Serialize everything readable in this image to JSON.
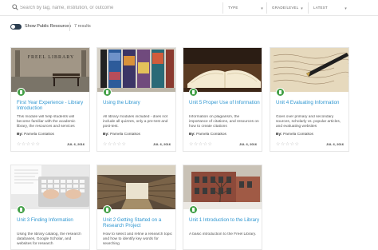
{
  "search": {
    "placeholder": "Search by tag, name, institution, or outcome"
  },
  "filters": {
    "type": "TYPE",
    "grade": "GRADE/LEVEL",
    "sort": "LATEST"
  },
  "toggle": {
    "label": "Show Public Resources",
    "on": true
  },
  "results_count": "7 results",
  "cards": [
    {
      "title": "First Year Experience - Library Introduction",
      "description": "This module will help students will become familiar with the academic library, the resources and services",
      "author_prefix": "By:",
      "author": "Pamela Contakos",
      "date": "JUL 6, 2016",
      "rating": 0
    },
    {
      "title": "Using the Library",
      "description": "All library modules included - does not include all quizzes, only a pre-test and post-test.",
      "author_prefix": "By:",
      "author": "Pamela Contakos",
      "date": "JUL 6, 2016",
      "rating": 0
    },
    {
      "title": "Unit 5 Proper Use of Information",
      "description": "Information on plagiarism, the importance of citations, and resources on how to create citations",
      "author_prefix": "By:",
      "author": "Pamela Contakos",
      "date": "JUL 6, 2016",
      "rating": 0
    },
    {
      "title": "Unit 4 Evaluating Information",
      "description": "Goes over primary and secondary sources, scholarly vs. popular articles, and evaluating websites",
      "author_prefix": "By:",
      "author": "Pamela Contakos",
      "date": "JUL 6, 2016",
      "rating": 0
    },
    {
      "title": "Unit 3 Finding Information",
      "description": "Using the library catalog, the research databases, Google Scholar, and websites for research",
      "author_prefix": "",
      "author": "",
      "date": "",
      "rating": 0
    },
    {
      "title": "Unit 2 Getting Started on a Research Project",
      "description": "How to select and refine a research topic and how to identify key words for searching",
      "author_prefix": "",
      "author": "",
      "date": "",
      "rating": 0
    },
    {
      "title": "Unit 1 Introduction to the Library",
      "description": "A basic introduction to the Freel Library.",
      "author_prefix": "",
      "author": "",
      "date": "",
      "rating": 0
    }
  ],
  "thumb_texts": {
    "freel_sign": "FREEL LIBRARY"
  },
  "colors": {
    "accent": "#2f97d1",
    "badge": "#43a047",
    "toggle": "#2c3e50"
  }
}
